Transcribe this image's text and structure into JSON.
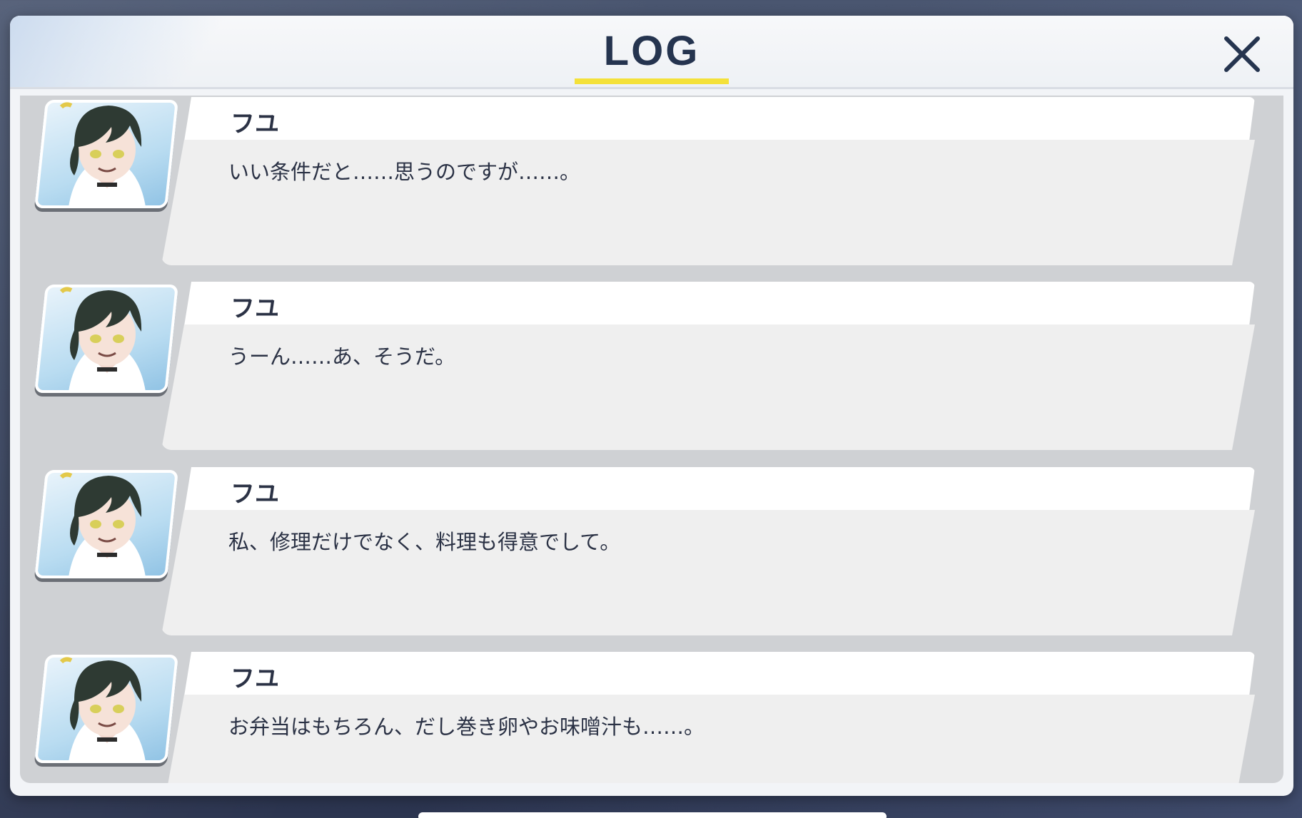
{
  "window": {
    "title": "LOG",
    "close_icon": "close-icon"
  },
  "log": {
    "entries": [
      {
        "speaker": "フユ",
        "message": "いい条件だと……思うのですが……。",
        "avatar": "character-portrait"
      },
      {
        "speaker": "フユ",
        "message": "うーん……あ、そうだ。",
        "avatar": "character-portrait"
      },
      {
        "speaker": "フユ",
        "message": "私、修理だけでなく、料理も得意でして。",
        "avatar": "character-portrait"
      },
      {
        "speaker": "フユ",
        "message": "お弁当はもちろん、だし巻き卵やお味噌汁も……。",
        "avatar": "character-portrait"
      }
    ]
  },
  "colors": {
    "title": "#25344f",
    "title_underline": "#f4e13a",
    "panel": "#f2f4f7",
    "list_background": "#cfd1d4",
    "bubble_body": "#efefef",
    "bubble_name": "#ffffff",
    "text": "#2b3245"
  }
}
